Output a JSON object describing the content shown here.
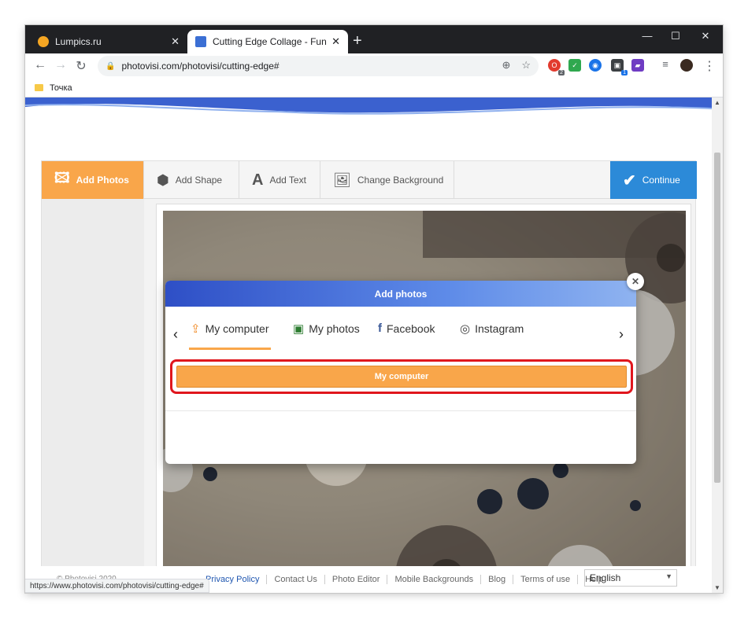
{
  "browser": {
    "tabs": [
      {
        "title": "Lumpics.ru",
        "favicon_color": "#f5a623",
        "active": false
      },
      {
        "title": "Cutting Edge Collage - Fun | Pho",
        "favicon_color": "#3b6fd4",
        "active": true
      }
    ],
    "window_controls": {
      "minimize": "—",
      "maximize": "☐",
      "close": "✕"
    },
    "url": "photovisi.com/photovisi/cutting-edge#",
    "bookmark": "Точка",
    "status_url": "https://www.photovisi.com/photovisi/cutting-edge#",
    "extensions": [
      {
        "name": "opera-icon",
        "color": "#e23b2e",
        "badge": "2"
      },
      {
        "name": "check-icon",
        "color": "#2fa84f",
        "badge": ""
      },
      {
        "name": "globe-icon",
        "color": "#1a73e8",
        "badge": ""
      },
      {
        "name": "cube-icon",
        "color": "#3c4043",
        "badge": "1"
      },
      {
        "name": "purple-ext-icon",
        "color": "#6f3cc3",
        "badge": ""
      }
    ]
  },
  "editor": {
    "toolbar": {
      "add_photos": "Add Photos",
      "add_shape": "Add Shape",
      "add_text": "Add Text",
      "change_background": "Change Background",
      "continue": "Continue"
    }
  },
  "modal": {
    "title": "Add photos",
    "close": "✕",
    "sources": [
      {
        "label": "My computer",
        "icon": "upload-icon",
        "active": true
      },
      {
        "label": "My photos",
        "icon": "photos-icon",
        "active": false
      },
      {
        "label": "Facebook",
        "icon": "facebook-icon",
        "active": false
      },
      {
        "label": "Instagram",
        "icon": "instagram-icon",
        "active": false
      }
    ],
    "upload_button": "My computer"
  },
  "footer": {
    "copyright": "© Photovisi 2020",
    "links": [
      "Privacy Policy",
      "Contact Us",
      "Photo Editor",
      "Mobile Backgrounds",
      "Blog",
      "Terms of use",
      "Help"
    ],
    "language": "English"
  },
  "colors": {
    "accent_orange": "#f9a64a",
    "continue_blue": "#2c8ad8",
    "highlight_red": "#e0161d"
  }
}
